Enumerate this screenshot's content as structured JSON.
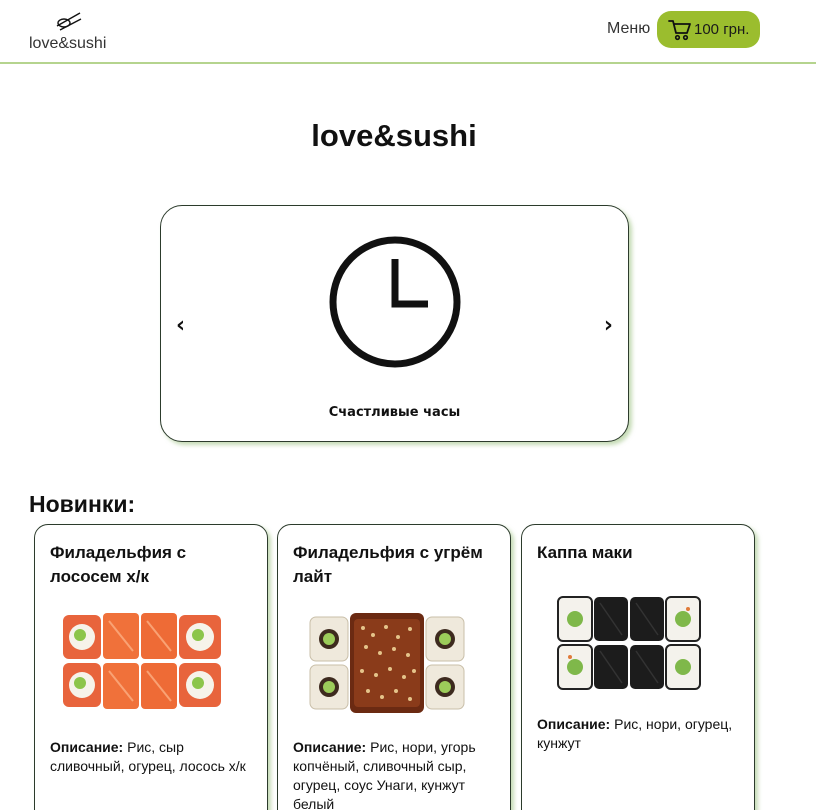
{
  "header": {
    "logo_text": "love&sushi",
    "menu_label": "Меню",
    "cart_label": "100 грн."
  },
  "main": {
    "title": "love&sushi",
    "slider": {
      "prev_label": "‹",
      "next_label": "›",
      "slide_caption": "Счастливые часы",
      "slide_icon": "clock-icon"
    },
    "section_title": "Новинки:",
    "products": [
      {
        "name": "Филадельфия с лососем х/к",
        "image_icon": "salmon-roll-image",
        "description_label": "Описание:",
        "description": "Рис, сыр сливочный, огурец, лосось х/к"
      },
      {
        "name": "Филадельфия с угрём лайт",
        "image_icon": "eel-roll-image",
        "description_label": "Описание:",
        "description": "Рис, нори, угорь копчёный, сливочный сыр, огурец, соус Унаги, кунжут белый"
      },
      {
        "name": "Каппа маки",
        "image_icon": "kappa-maki-image",
        "description_label": "Описание:",
        "description": "Рис, нори, огурец, кунжут"
      }
    ]
  },
  "colors": {
    "accent": "#9bbd2e",
    "header_border": "#b5d48e",
    "card_border": "#2c3b2c"
  }
}
